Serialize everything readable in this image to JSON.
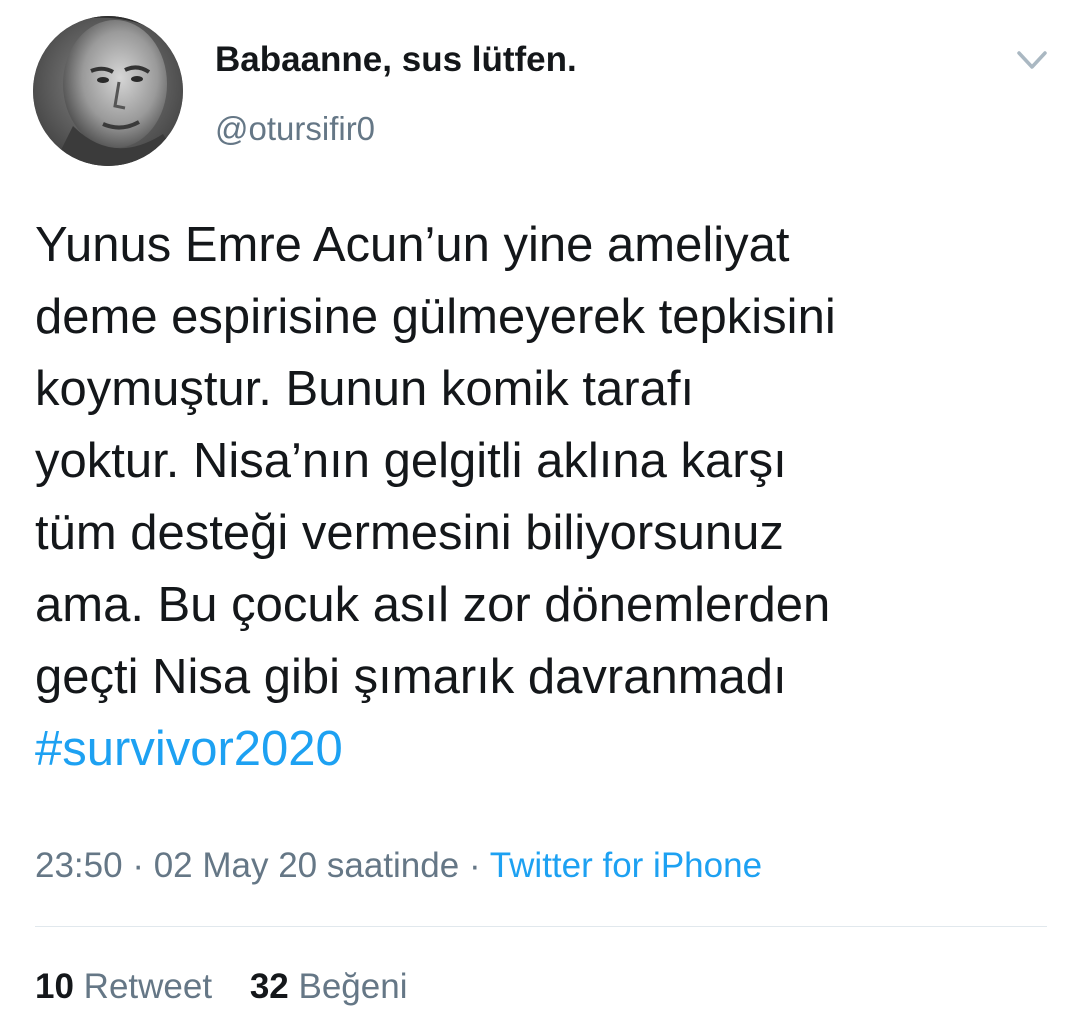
{
  "user": {
    "display_name": "Babaanne, sus lütfen.",
    "handle": "@otursifir0",
    "avatar_icon": "avatar-photo"
  },
  "menu_icon": "chevron-down-icon",
  "tweet": {
    "lines": [
      "Yunus Emre Acun’un yine ameliyat",
      "deme espirisine gülmeyerek tepkisini",
      "koymuştur. Bunun komik tarafı",
      "yoktur. Nisa’nın gelgitli aklına karşı",
      "tüm desteği vermesini biliyorsunuz",
      "ama. Bu çocuk asıl zor dönemlerden",
      "geçti Nisa gibi şımarık davranmadı"
    ],
    "hashtag": "#survivor2020"
  },
  "meta": {
    "time": "23:50",
    "separator": "·",
    "date": "02 May 20 saatinde",
    "source": "Twitter for iPhone"
  },
  "stats": {
    "retweets": {
      "count": "10",
      "label": "Retweet"
    },
    "likes": {
      "count": "32",
      "label": "Beğeni"
    }
  },
  "colors": {
    "link": "#1da1f2",
    "secondary": "#657786",
    "primary": "#14171a",
    "divider": "#e1e8ed"
  }
}
